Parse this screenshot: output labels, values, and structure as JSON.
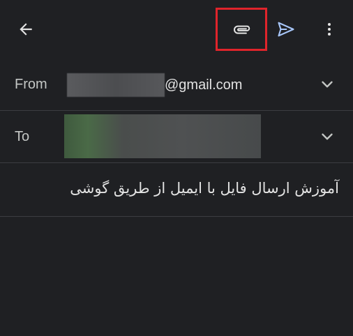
{
  "toolbar": {
    "back_icon": "arrow-back-icon",
    "attach_icon": "paperclip-icon",
    "send_icon": "send-icon",
    "more_icon": "more-vert-icon",
    "highlight_color": "#e0242b",
    "send_color": "#a8c7fa"
  },
  "from": {
    "label": "From",
    "email_domain": "@gmail.com"
  },
  "to": {
    "label": "To"
  },
  "subject": {
    "text": "آموزش ارسال فایل با ایمیل از طریق گوشی"
  }
}
